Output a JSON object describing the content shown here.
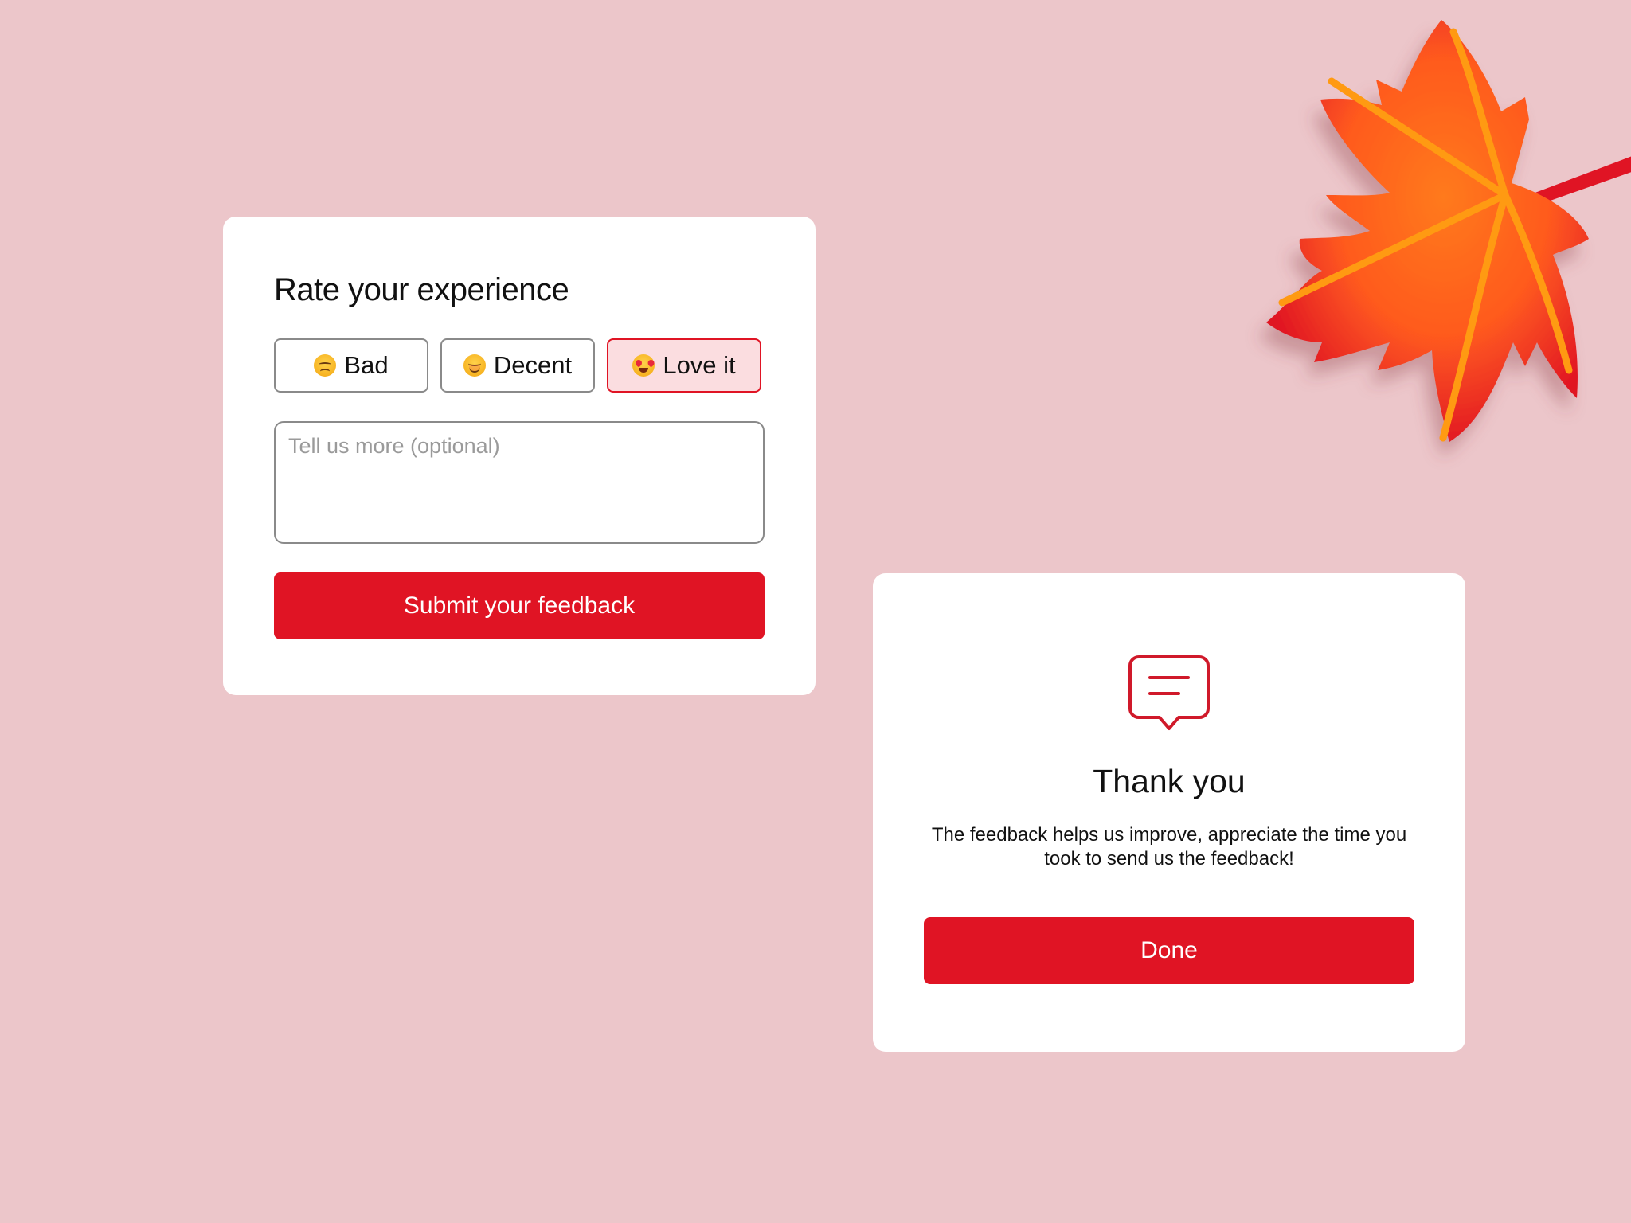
{
  "rating_card": {
    "title": "Rate your experience",
    "options": [
      {
        "label": "Bad",
        "icon": "sad-face-icon",
        "selected": false
      },
      {
        "label": "Decent",
        "icon": "smiling-face-icon",
        "selected": false
      },
      {
        "label": "Love it",
        "icon": "heart-eyes-face-icon",
        "selected": true
      }
    ],
    "comment": {
      "value": "",
      "placeholder": "Tell us more (optional)"
    },
    "submit_label": "Submit your feedback"
  },
  "thanks_card": {
    "icon": "chat-bubble-icon",
    "title": "Thank you",
    "message": "The feedback helps us improve, appreciate the time you took to send us the feedback!",
    "done_label": "Done"
  },
  "decoration": {
    "icon": "maple-leaf-icon"
  },
  "colors": {
    "background": "#ecc6ca",
    "accent": "#e01424",
    "selected_fill": "#fbdde0"
  }
}
